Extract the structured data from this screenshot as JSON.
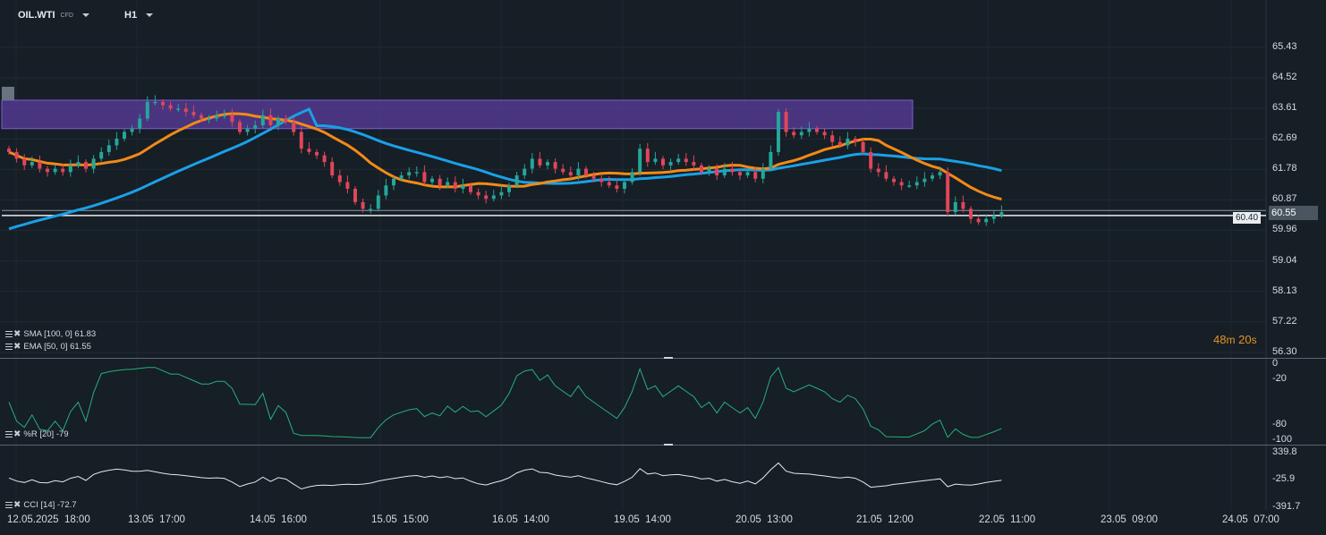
{
  "header": {
    "symbol": "OIL.WTI",
    "symbol_type": "CFD",
    "timeframe": "H1"
  },
  "price_axis": [
    "65.43",
    "64.52",
    "63.61",
    "62.69",
    "61.78",
    "60.87",
    "59.96",
    "59.04",
    "58.13",
    "57.22",
    "56.30"
  ],
  "current_price": "60.55",
  "line_price_label": "60.40",
  "countdown": {
    "minutes": "48",
    "m": "m",
    "seconds": "20",
    "s": "s"
  },
  "indicators": {
    "sma": {
      "name": "SMA",
      "label": "SMA [100, 0] 61.83",
      "value": 61.83,
      "color": "#1aa0e6"
    },
    "ema": {
      "name": "EMA",
      "label": "EMA [50, 0] 61.55",
      "value": 61.55,
      "color": "#f28a17"
    },
    "wr": {
      "label": "%R [20] -79",
      "value": -79,
      "axis": [
        "0",
        "-20",
        "-80",
        "-100"
      ]
    },
    "cci": {
      "label": "CCI [14] -72.7",
      "value": -72.7,
      "axis": [
        "339.8",
        "-25.9",
        "-391.7"
      ]
    }
  },
  "time_axis": [
    "12.05.2025  18:00",
    "13.05  17:00",
    "14.05  16:00",
    "15.05  15:00",
    "16.05  14:00",
    "19.05  14:00",
    "20.05  13:00",
    "21.05  12:00",
    "22.05  11:00",
    "23.05  09:00",
    "24.05  07:00"
  ],
  "colors": {
    "background": "#161e26",
    "bull": "#26a69a",
    "bear": "#e0465a",
    "zone": "#5a3c9e",
    "grid": "#222c36"
  },
  "zone": {
    "top": 63.85,
    "bottom": 63.0
  },
  "horizontal_lines": [
    60.55,
    60.4
  ],
  "chart_data": {
    "type": "candlestick",
    "y_range": [
      56.3,
      65.43
    ],
    "candles_close": [
      62.3,
      62.1,
      61.9,
      62.0,
      61.8,
      61.7,
      61.8,
      61.7,
      61.9,
      62.0,
      61.8,
      62.1,
      62.3,
      62.5,
      62.7,
      62.9,
      63.0,
      63.3,
      63.8,
      63.8,
      63.7,
      63.6,
      63.6,
      63.5,
      63.4,
      63.3,
      63.3,
      63.4,
      63.4,
      63.2,
      62.9,
      63.0,
      63.1,
      63.4,
      63.1,
      63.3,
      63.2,
      62.9,
      62.4,
      62.3,
      62.2,
      62.0,
      61.6,
      61.4,
      61.2,
      60.8,
      60.6,
      60.6,
      61.0,
      61.3,
      61.5,
      61.6,
      61.7,
      61.7,
      61.4,
      61.5,
      61.3,
      61.4,
      61.2,
      61.3,
      61.1,
      61.0,
      60.9,
      61.0,
      61.1,
      61.3,
      61.6,
      61.8,
      62.1,
      61.9,
      62.0,
      61.8,
      61.7,
      61.6,
      61.8,
      61.6,
      61.5,
      61.4,
      61.3,
      61.2,
      61.4,
      61.7,
      62.4,
      62.0,
      62.1,
      61.9,
      62.0,
      62.1,
      62.0,
      61.9,
      61.7,
      61.8,
      61.6,
      61.8,
      61.7,
      61.6,
      61.7,
      61.5,
      61.8,
      62.3,
      63.5,
      62.9,
      62.8,
      62.9,
      63.0,
      62.9,
      62.8,
      62.6,
      62.5,
      62.7,
      62.6,
      62.3,
      61.8,
      61.7,
      61.5,
      61.4,
      61.3,
      61.3,
      61.4,
      61.5,
      61.6,
      61.7,
      60.5,
      60.8,
      60.6,
      60.3,
      60.2,
      60.3,
      60.4,
      60.5
    ]
  }
}
